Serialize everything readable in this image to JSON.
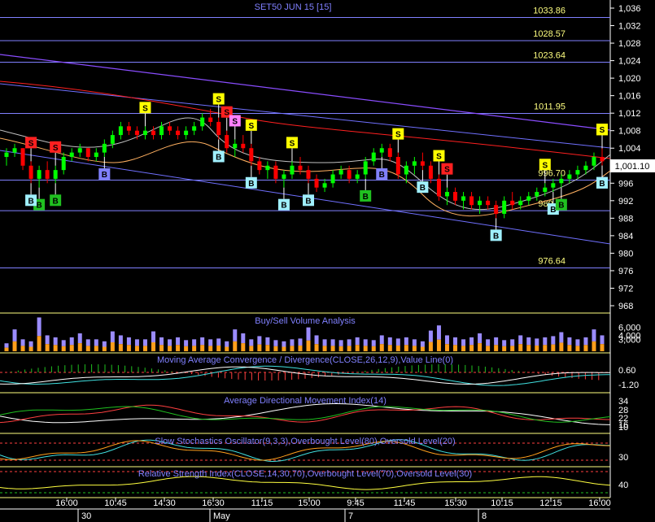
{
  "chart_data": {
    "type": "candlestick",
    "title": "SET50 JUN 15   [15]",
    "last_price": "1,001.10",
    "price_axis": {
      "min": 960,
      "max": 1036,
      "ticks": [
        "1,036",
        "1,032",
        "1,028",
        "1,024",
        "1,020",
        "1,016",
        "1,012",
        "1,008",
        "1,004",
        "1,000",
        "996",
        "992",
        "988",
        "984",
        "980",
        "976",
        "972",
        "968"
      ]
    },
    "horizontal_levels": [
      {
        "value": 1033.86,
        "label": "1033.86"
      },
      {
        "value": 1028.57,
        "label": "1028.57"
      },
      {
        "value": 1023.64,
        "label": "1023.64"
      },
      {
        "value": 1011.95,
        "label": "1011.95"
      },
      {
        "value": 996.7,
        "label": "996.70"
      },
      {
        "value": 989.72,
        "label": "989.72"
      },
      {
        "value": 976.64,
        "label": "976.64"
      }
    ],
    "candles": [
      [
        1002,
        1004,
        1000,
        1003
      ],
      [
        1003,
        1005,
        1002,
        1004
      ],
      [
        1004,
        1004,
        999,
        1000
      ],
      [
        1000,
        1001,
        996,
        997
      ],
      [
        997,
        1000,
        995,
        999
      ],
      [
        999,
        1001,
        996,
        997
      ],
      [
        997,
        1000,
        996,
        999
      ],
      [
        999,
        1003,
        998,
        1002
      ],
      [
        1002,
        1004,
        1001,
        1003
      ],
      [
        1003,
        1005,
        1002,
        1004
      ],
      [
        1004,
        1004,
        1001,
        1002
      ],
      [
        1002,
        1004,
        1001,
        1003
      ],
      [
        1003,
        1006,
        1002,
        1005
      ],
      [
        1005,
        1008,
        1004,
        1007
      ],
      [
        1007,
        1010,
        1006,
        1009
      ],
      [
        1009,
        1010,
        1007,
        1008
      ],
      [
        1008,
        1009,
        1006,
        1007
      ],
      [
        1007,
        1009,
        1006,
        1008
      ],
      [
        1008,
        1009,
        1006,
        1007
      ],
      [
        1007,
        1010,
        1006,
        1009
      ],
      [
        1009,
        1010,
        1007,
        1008
      ],
      [
        1008,
        1009,
        1006,
        1007
      ],
      [
        1007,
        1009,
        1006,
        1008
      ],
      [
        1008,
        1010,
        1007,
        1009
      ],
      [
        1009,
        1012,
        1008,
        1011
      ],
      [
        1011,
        1013,
        1009,
        1010
      ],
      [
        1010,
        1011,
        1006,
        1007
      ],
      [
        1007,
        1008,
        1003,
        1004
      ],
      [
        1004,
        1006,
        1002,
        1005
      ],
      [
        1005,
        1007,
        1003,
        1004
      ],
      [
        1004,
        1005,
        1000,
        1001
      ],
      [
        1001,
        1002,
        998,
        999
      ],
      [
        999,
        1001,
        997,
        1000
      ],
      [
        1000,
        1001,
        996,
        997
      ],
      [
        997,
        999,
        995,
        998
      ],
      [
        998,
        1001,
        997,
        1000
      ],
      [
        1000,
        1002,
        998,
        999
      ],
      [
        999,
        1000,
        996,
        997
      ],
      [
        997,
        998,
        994,
        995
      ],
      [
        995,
        997,
        994,
        996
      ],
      [
        996,
        999,
        995,
        998
      ],
      [
        998,
        1000,
        997,
        999
      ],
      [
        999,
        1000,
        996,
        997
      ],
      [
        997,
        999,
        996,
        998
      ],
      [
        998,
        1002,
        997,
        1001
      ],
      [
        1001,
        1004,
        1000,
        1003
      ],
      [
        1003,
        1005,
        1002,
        1004
      ],
      [
        1004,
        1005,
        1001,
        1002
      ],
      [
        1002,
        1003,
        997,
        998
      ],
      [
        998,
        1001,
        996,
        1000
      ],
      [
        1000,
        1002,
        998,
        1001
      ],
      [
        1001,
        1003,
        999,
        1000
      ],
      [
        1000,
        1001,
        996,
        997
      ],
      [
        997,
        998,
        992,
        993
      ],
      [
        993,
        995,
        991,
        994
      ],
      [
        994,
        995,
        991,
        992
      ],
      [
        992,
        994,
        990,
        993
      ],
      [
        993,
        994,
        990,
        991
      ],
      [
        991,
        993,
        989,
        992
      ],
      [
        992,
        993,
        990,
        991
      ],
      [
        991,
        992,
        988,
        989
      ],
      [
        989,
        993,
        988,
        992
      ],
      [
        992,
        994,
        990,
        991
      ],
      [
        991,
        993,
        990,
        992
      ],
      [
        992,
        994,
        991,
        993
      ],
      [
        993,
        995,
        992,
        994
      ],
      [
        994,
        996,
        993,
        995
      ],
      [
        995,
        997,
        994,
        996
      ],
      [
        996,
        998,
        995,
        997
      ],
      [
        997,
        999,
        996,
        998
      ],
      [
        998,
        1000,
        997,
        999
      ],
      [
        999,
        1001,
        998,
        1000
      ],
      [
        1000,
        1003,
        999,
        1002
      ],
      [
        1002,
        1004,
        1000,
        1001
      ]
    ],
    "signals": [
      {
        "index": 3,
        "type": "S",
        "color": "red"
      },
      {
        "index": 6,
        "type": "S",
        "color": "red"
      },
      {
        "index": 4,
        "type": "B",
        "color": "green"
      },
      {
        "index": 6,
        "type": "B",
        "color": "green"
      },
      {
        "index": 3,
        "type": "B",
        "color": "cyan"
      },
      {
        "index": 12,
        "type": "B",
        "color": "purple"
      },
      {
        "index": 17,
        "type": "S",
        "color": "yellow"
      },
      {
        "index": 26,
        "type": "S",
        "color": "yellow"
      },
      {
        "index": 27,
        "type": "S",
        "color": "red"
      },
      {
        "index": 28,
        "type": "S",
        "color": "pink"
      },
      {
        "index": 30,
        "type": "S",
        "color": "yellow"
      },
      {
        "index": 26,
        "type": "B",
        "color": "cyan"
      },
      {
        "index": 30,
        "type": "B",
        "color": "cyan"
      },
      {
        "index": 35,
        "type": "S",
        "color": "yellow"
      },
      {
        "index": 34,
        "type": "B",
        "color": "cyan"
      },
      {
        "index": 37,
        "type": "B",
        "color": "cyan"
      },
      {
        "index": 44,
        "type": "B",
        "color": "green"
      },
      {
        "index": 46,
        "type": "B",
        "color": "purple"
      },
      {
        "index": 48,
        "type": "S",
        "color": "yellow"
      },
      {
        "index": 51,
        "type": "B",
        "color": "cyan"
      },
      {
        "index": 53,
        "type": "S",
        "color": "yellow"
      },
      {
        "index": 54,
        "type": "S",
        "color": "red"
      },
      {
        "index": 60,
        "type": "B",
        "color": "cyan"
      },
      {
        "index": 66,
        "type": "S",
        "color": "yellow"
      },
      {
        "index": 67,
        "type": "B",
        "color": "cyan"
      },
      {
        "index": 68,
        "type": "B",
        "color": "green"
      },
      {
        "index": 74,
        "type": "B",
        "color": "purple"
      },
      {
        "index": 78,
        "type": "S",
        "color": "yellow"
      },
      {
        "index": 80,
        "type": "S",
        "color": "yellow"
      },
      {
        "index": 80,
        "type": "B",
        "color": "cyan"
      },
      {
        "index": 82,
        "type": "B",
        "color": "cyan"
      },
      {
        "index": 83,
        "type": "S",
        "color": "yellow"
      }
    ],
    "volume_panel": {
      "title": "Buy/Sell Volume Analysis",
      "ticks": [
        "6,000",
        "4,000",
        "3,000"
      ],
      "values": [
        2000,
        5500,
        3000,
        2500,
        8500,
        4000,
        3500,
        2800,
        3500,
        4500,
        3000,
        3000,
        2500,
        5000,
        4000,
        3500,
        3000,
        3000,
        5000,
        3500,
        3000,
        3500,
        2800,
        3000,
        3500,
        3000,
        3200,
        2500,
        5500,
        4500,
        3000,
        3800,
        3500,
        2800,
        2500,
        3000,
        3200,
        6000,
        4000,
        3000,
        3000,
        2800,
        3000,
        3500,
        3000,
        2800,
        4000,
        3500,
        3200,
        3500,
        3000,
        2500,
        5200,
        6500,
        4000,
        3500,
        3000,
        3500,
        4500,
        3000,
        3500,
        2800,
        3000,
        4000,
        3500,
        3200,
        3500,
        3800,
        4800,
        3500,
        3000,
        3500,
        5500,
        4000
      ]
    },
    "macd_panel": {
      "title": "Moving Average Convergence / Divergence(CLOSE,26,12,9),Value Line(0)",
      "ticks": [
        "0.60",
        "-1.20"
      ]
    },
    "adx_panel": {
      "title": "Average Directional Movement Index(14)",
      "ticks": [
        "34",
        "28",
        "22",
        "16",
        "10"
      ]
    },
    "stoch_panel": {
      "title": "Slow Stochastics Oscillator(9,3,3),Overbought Level(80),Oversold Level(20)",
      "ticks": [
        "30"
      ]
    },
    "rsi_panel": {
      "title": "Relative Strength Index(CLOSE,14,30,70),Overbought Level(70),Oversold Level(30)",
      "ticks": [
        "40"
      ]
    },
    "time_axis": {
      "times": [
        "16:00",
        "10:45",
        "14:30",
        "16:30",
        "11:15",
        "15:00",
        "9:45",
        "11:45",
        "15:30",
        "10:15",
        "12:15",
        "16:00"
      ],
      "dates": [
        "30",
        "May",
        "7",
        "8"
      ]
    }
  },
  "colors": {
    "background": "#000000",
    "up": "#00ff00",
    "down": "#ff0000",
    "grid_level": "#8080ff",
    "level_label": "#ffff80",
    "title": "#8080ff",
    "axis_text": "#ffffff",
    "volume_buy": "#9b8cff",
    "volume_sell": "#ff9f1c"
  }
}
